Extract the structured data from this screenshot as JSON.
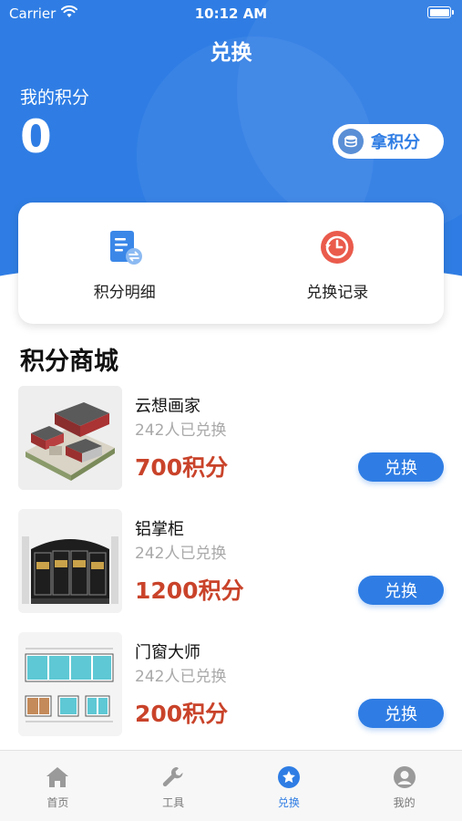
{
  "status_bar": {
    "carrier": "Carrier",
    "time": "10:12 AM"
  },
  "header": {
    "title": "兑换"
  },
  "points": {
    "label": "我的积分",
    "value": "0",
    "earn_label": "拿积分"
  },
  "quick_actions": [
    {
      "label": "积分明细",
      "icon": "document-exchange-icon"
    },
    {
      "label": "兑换记录",
      "icon": "clock-history-icon"
    }
  ],
  "section": {
    "title": "积分商城"
  },
  "products": [
    {
      "name": "云想画家",
      "redeemed": "242人已兑换",
      "price": "700积分",
      "button": "兑换",
      "image": "house-model-image"
    },
    {
      "name": "铝掌柜",
      "redeemed": "242人已兑换",
      "price": "1200积分",
      "button": "兑换",
      "image": "aluminum-gate-image"
    },
    {
      "name": "门窗大师",
      "redeemed": "242人已兑换",
      "price": "200积分",
      "button": "兑换",
      "image": "window-drawing-image"
    }
  ],
  "tabbar": [
    {
      "label": "首页",
      "icon": "home-icon",
      "active": false
    },
    {
      "label": "工具",
      "icon": "wrench-icon",
      "active": false
    },
    {
      "label": "兑换",
      "icon": "star-icon",
      "active": true
    },
    {
      "label": "我的",
      "icon": "profile-icon",
      "active": false
    }
  ],
  "colors": {
    "primary": "#2f7de4",
    "price": "#c9432a",
    "muted": "#a9a9a9"
  }
}
